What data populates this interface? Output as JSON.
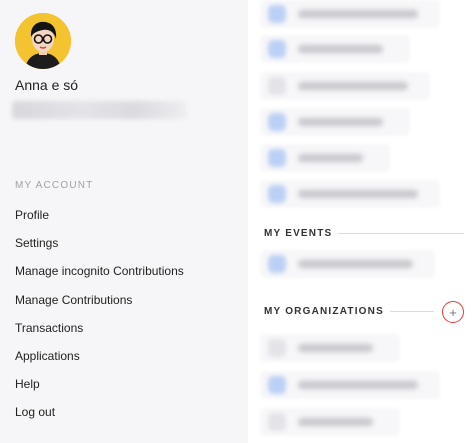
{
  "user": {
    "name": "Anna e só"
  },
  "account": {
    "section_label": "MY ACCOUNT",
    "menu": [
      {
        "label": "Profile"
      },
      {
        "label": "Settings"
      },
      {
        "label": "Manage incognito Contributions"
      },
      {
        "label": "Manage Contributions"
      },
      {
        "label": "Transactions"
      },
      {
        "label": "Applications"
      },
      {
        "label": "Help"
      },
      {
        "label": "Log out"
      }
    ]
  },
  "events": {
    "heading": "MY EVENTS"
  },
  "organizations": {
    "heading": "MY ORGANIZATIONS",
    "add_label": "+"
  },
  "colors": {
    "accent_ring": "#e53935",
    "avatar_bg": "#f4c430"
  }
}
